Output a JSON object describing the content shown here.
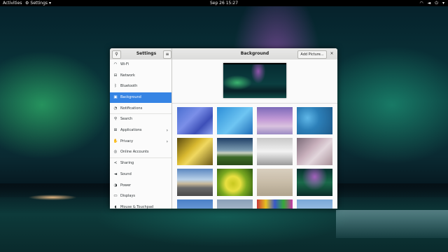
{
  "topbar": {
    "activities": "Activities",
    "app_menu": "Settings",
    "clock": "Sep 26  15:27",
    "status_icons": [
      "wifi-icon",
      "volume-icon",
      "power-icon"
    ]
  },
  "window": {
    "sidebar_title": "Settings",
    "panel_title": "Background",
    "add_picture_label": "Add Picture...",
    "close_glyph": "×",
    "search_glyph": "⚲",
    "menu_glyph": "≡"
  },
  "sidebar": {
    "items": [
      {
        "label": "Wi-Fi",
        "icon": "wifi-icon",
        "glyph": "◠",
        "active": false,
        "chevron": false
      },
      {
        "label": "Network",
        "icon": "network-icon",
        "glyph": "⊟",
        "active": false,
        "chevron": false
      },
      {
        "label": "Bluetooth",
        "icon": "bluetooth-icon",
        "glyph": "ᛒ",
        "active": false,
        "chevron": false
      },
      {
        "label": "Background",
        "icon": "background-icon",
        "glyph": "▣",
        "active": true,
        "chevron": false
      },
      {
        "label": "Notifications",
        "icon": "notifications-icon",
        "glyph": "◔",
        "active": false,
        "chevron": false
      },
      {
        "label": "Search",
        "icon": "search-icon",
        "glyph": "⚲",
        "active": false,
        "chevron": false
      },
      {
        "label": "Applications",
        "icon": "applications-icon",
        "glyph": "⊞",
        "active": false,
        "chevron": true
      },
      {
        "label": "Privacy",
        "icon": "privacy-icon",
        "glyph": "✋",
        "active": false,
        "chevron": true
      },
      {
        "label": "Online Accounts",
        "icon": "online-accounts-icon",
        "glyph": "◎",
        "active": false,
        "chevron": false
      },
      {
        "label": "Sharing",
        "icon": "sharing-icon",
        "glyph": "≺",
        "active": false,
        "chevron": false
      },
      {
        "label": "Sound",
        "icon": "sound-icon",
        "glyph": "◄",
        "active": false,
        "chevron": false
      },
      {
        "label": "Power",
        "icon": "power-icon",
        "glyph": "◑",
        "active": false,
        "chevron": false
      },
      {
        "label": "Displays",
        "icon": "displays-icon",
        "glyph": "▭",
        "active": false,
        "chevron": false
      },
      {
        "label": "Mouse & Touchpad",
        "icon": "mouse-icon",
        "glyph": "◖",
        "active": false,
        "chevron": false
      }
    ],
    "chevron_glyph": "›"
  },
  "gallery": {
    "wallpapers": [
      "geometric-blue",
      "blue-streaks",
      "purple-landscape",
      "blue-dots",
      "golden-leaf",
      "green-field-sky",
      "white-chairs",
      "pink-blossom",
      "desert-road",
      "yellow-frog",
      "zen-stones",
      "aurora-night",
      "sky-blue",
      "grey-sky",
      "colored-pencils",
      "light-sky"
    ]
  }
}
